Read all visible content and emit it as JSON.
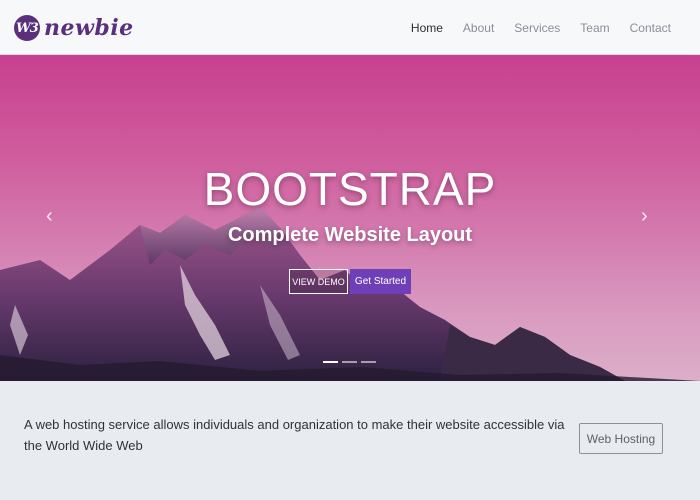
{
  "brand": {
    "mark": "W3",
    "name": "newbie"
  },
  "nav": {
    "items": [
      "Home",
      "About",
      "Services",
      "Team",
      "Contact"
    ],
    "active": "Home"
  },
  "hero": {
    "title": "BOOTSTRAP",
    "subtitle": "Complete Website Layout",
    "demo_label": "VIEW DEMO",
    "start_label": "Get Started",
    "prev_icon": "chevron-left-icon",
    "next_icon": "chevron-right-icon",
    "slides": 3,
    "active_slide": 1
  },
  "callout": {
    "text": "A web hosting service allows individuals and organization to make their website accessible via the World Wide Web",
    "button_label": "Web Hosting"
  },
  "colors": {
    "brand": "#5a2f7c",
    "primary_button": "#6f3fb8",
    "hero_top": "#c8408f",
    "hero_bottom": "#dcaec9"
  }
}
